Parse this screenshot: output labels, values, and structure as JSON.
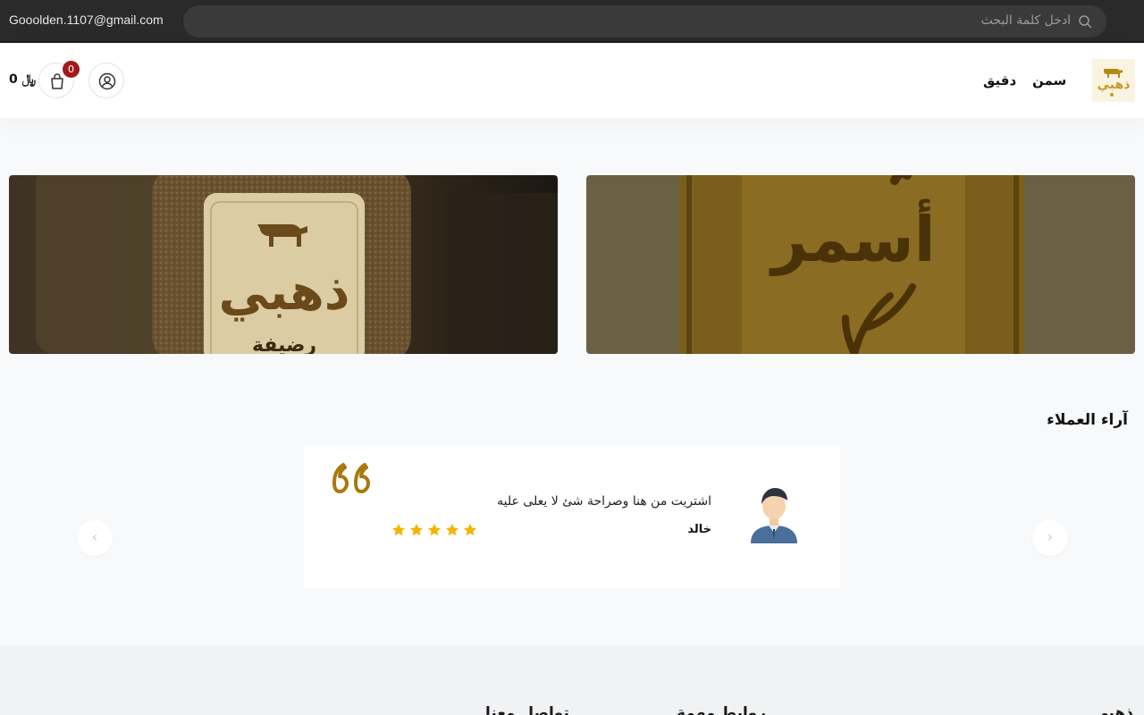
{
  "topbar": {
    "email": "Gooolden.1107@gmail.com",
    "search_placeholder": "ادخل كلمة البحث"
  },
  "header": {
    "logo_text": "ذهبي",
    "nav": [
      "سمن",
      "دقيق"
    ],
    "cart_count": "0",
    "cart_total": "0 ﷼"
  },
  "banners": [
    {
      "brand": "ذهبي",
      "subtitle": "رضيفة"
    },
    {
      "title": "أسمر"
    }
  ],
  "testimonials": {
    "title": "آراء العملاء",
    "items": [
      {
        "text": "اشتريت من هنا وصراحة شئ لا يعلى عليه",
        "name": "خالد",
        "rating": 5
      }
    ],
    "prev_icon": "chevron-left-icon",
    "next_icon": "chevron-right-icon"
  },
  "footer": {
    "headings": [
      "ذهبي",
      "روابط مهمة",
      "تواصل معنا"
    ]
  },
  "colors": {
    "accent": "#a8780e",
    "badge": "#a11a1a",
    "star": "#f5b301",
    "topbar": "#2a2a2a"
  }
}
